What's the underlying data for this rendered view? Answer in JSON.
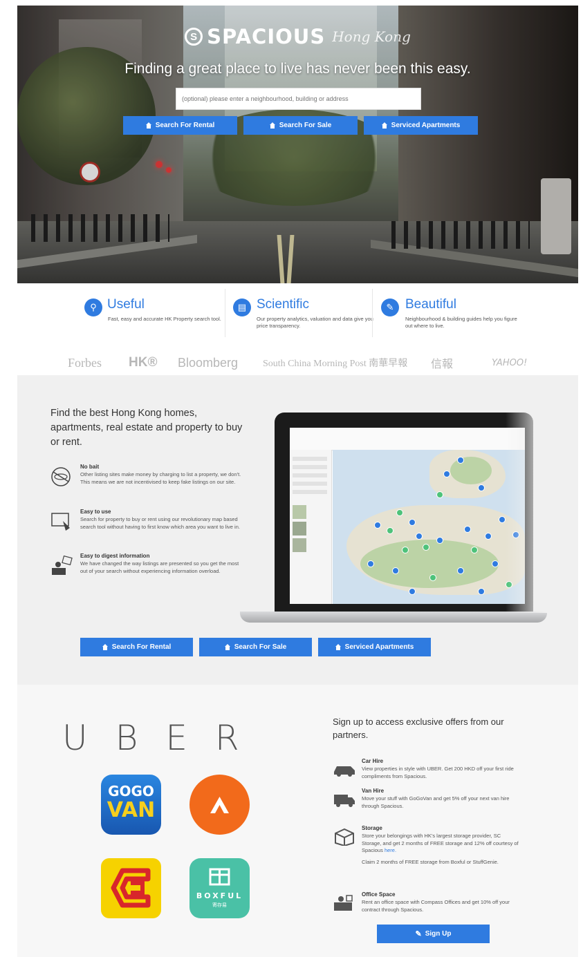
{
  "hero": {
    "brand": "SPACIOUS",
    "city": "Hong Kong",
    "tagline": "Finding a great place to live has never been this easy.",
    "search_placeholder": "(optional) please enter a neighbourhood, building or address",
    "buttons": [
      "Search For Rental",
      "Search For Sale",
      "Serviced Apartments"
    ]
  },
  "features": [
    {
      "title": "Useful",
      "desc": "Fast, easy and accurate HK Property search tool."
    },
    {
      "title": "Scientific",
      "desc": "Our property analytics, valuation and data give you price transparency."
    },
    {
      "title": "Beautiful",
      "desc": "Neighbourhood & building guides help you figure out where to live."
    }
  ],
  "press": [
    "Forbes",
    "HK®",
    "Bloomberg",
    "South China Morning Post 南華早報",
    "信報",
    "YAHOO!"
  ],
  "section2": {
    "title": "Find the best Hong Kong homes, apartments, real estate and property to buy or rent.",
    "items": [
      {
        "title": "No bait",
        "desc": "Other listing sites make money by charging to list a property, we don't. This means we are not incentivised to keep fake listings on our site."
      },
      {
        "title": "Easy to use",
        "desc": "Search for property to buy or rent using our revolutionary map based search tool without having to first know which area you want to live in."
      },
      {
        "title": "Easy to digest information",
        "desc": "We have changed the way listings are presented so you get the most out of your search without experiencing information overload."
      }
    ],
    "buttons": [
      "Search For Rental",
      "Search For Sale",
      "Serviced Apartments"
    ]
  },
  "section3": {
    "partner_brand": "UBER",
    "partner_logos": [
      "GOGO",
      "VAN",
      "BOXFUL",
      "寄存易"
    ],
    "title": "Sign up to access exclusive offers from our partners.",
    "offers": [
      {
        "title": "Car Hire",
        "desc": "View properties in style with UBER. Get 200 HKD off your first ride compliments from Spacious."
      },
      {
        "title": "Van Hire",
        "desc": "Move your stuff with GoGoVan and get 5% off your next van hire through Spacious."
      },
      {
        "title": "Storage",
        "desc": "Store your belongings with HK's largest storage provider, SC Storage, and get 2 months of FREE storage and 12% off courtesy of Spacious",
        "link": "here.",
        "extra": "Claim 2 months of FREE storage from Boxful or StuffGenie."
      },
      {
        "title": "Office Space",
        "desc": "Rent an office space with Compass Offices and get 10% off your contract through Spacious."
      }
    ],
    "signup_label": "Sign Up"
  },
  "colors": {
    "accent": "#2f7be0",
    "gogovan_blue": "#1f6fc9",
    "gogovan_yellow": "#f7cf1d",
    "orange": "#f26a1b",
    "sc_yellow": "#f6d200",
    "sc_red": "#d8262b",
    "boxful_teal": "#4ac1a6"
  }
}
